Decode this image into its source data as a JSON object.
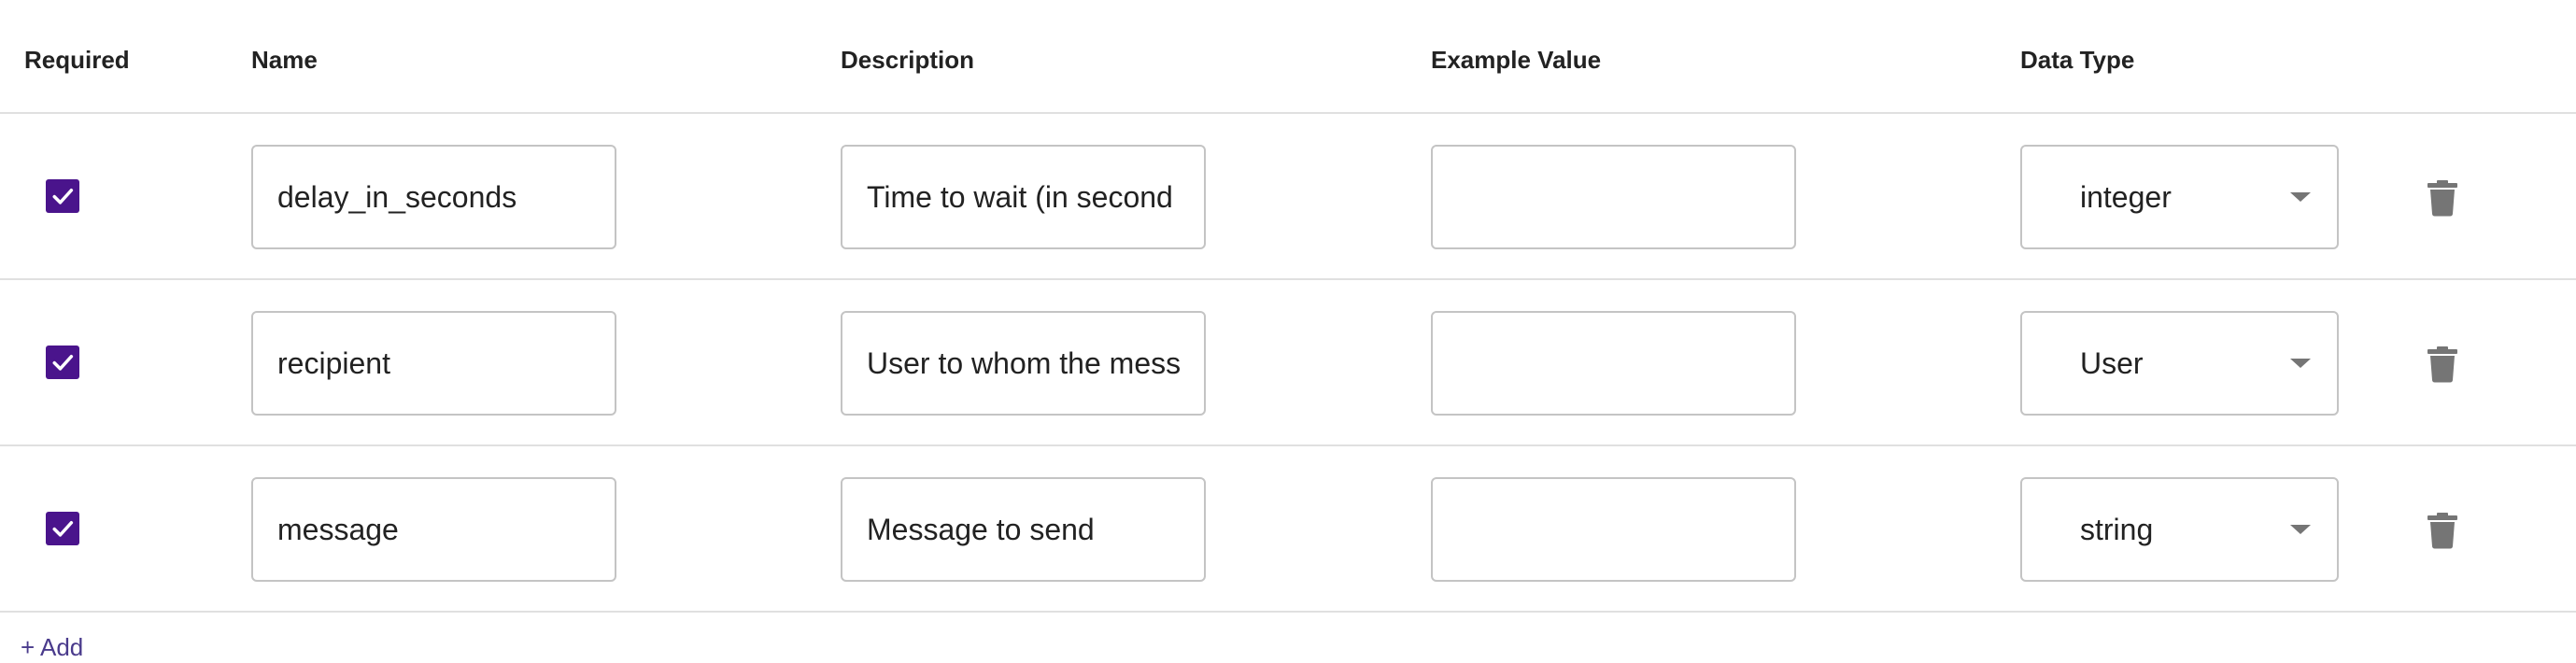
{
  "colors": {
    "accent": "#4a148c",
    "border": "#c4c4c4",
    "divider": "#e0e0e0",
    "icon": "#757575",
    "link": "#4a3b8c"
  },
  "headers": {
    "required": "Required",
    "name": "Name",
    "description": "Description",
    "example_value": "Example Value",
    "data_type": "Data Type"
  },
  "rows": [
    {
      "required": true,
      "name": "delay_in_seconds",
      "description": "Time to wait (in second",
      "example_value": "",
      "data_type": "integer",
      "checkbox_icon": "check-icon",
      "delete_icon": "trash-icon"
    },
    {
      "required": true,
      "name": "recipient",
      "description": "User to whom the mess",
      "example_value": "",
      "data_type": "User",
      "checkbox_icon": "check-icon",
      "delete_icon": "trash-icon"
    },
    {
      "required": true,
      "name": "message",
      "description": "Message to send",
      "example_value": "",
      "data_type": "string",
      "checkbox_icon": "check-icon",
      "delete_icon": "trash-icon"
    }
  ],
  "add_label": "+ Add"
}
